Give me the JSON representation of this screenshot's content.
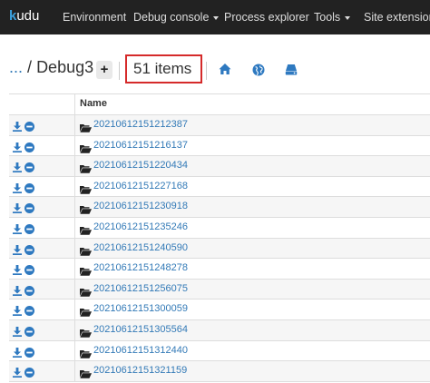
{
  "navbar": {
    "brand_k": "k",
    "brand_rest": "udu",
    "items": [
      "Environment",
      "Debug console",
      "Process explorer",
      "Tools",
      "Site extensions"
    ]
  },
  "toolbar": {
    "ellipsis": "...",
    "separator": "/",
    "folder": "Debug3",
    "plus": "+",
    "item_count": "51 items"
  },
  "table": {
    "name_header": "Name",
    "rows": [
      "20210612151212387",
      "20210612151216137",
      "20210612151220434",
      "20210612151227168",
      "20210612151230918",
      "20210612151235246",
      "20210612151240590",
      "20210612151248278",
      "20210612151256075",
      "20210612151300059",
      "20210612151305564",
      "20210612151312440",
      "20210612151321159"
    ]
  },
  "colors": {
    "navbar": "#222222",
    "link": "#337ab7",
    "highlight": "#d52a2a",
    "icon_blue": "#2e79c0"
  }
}
